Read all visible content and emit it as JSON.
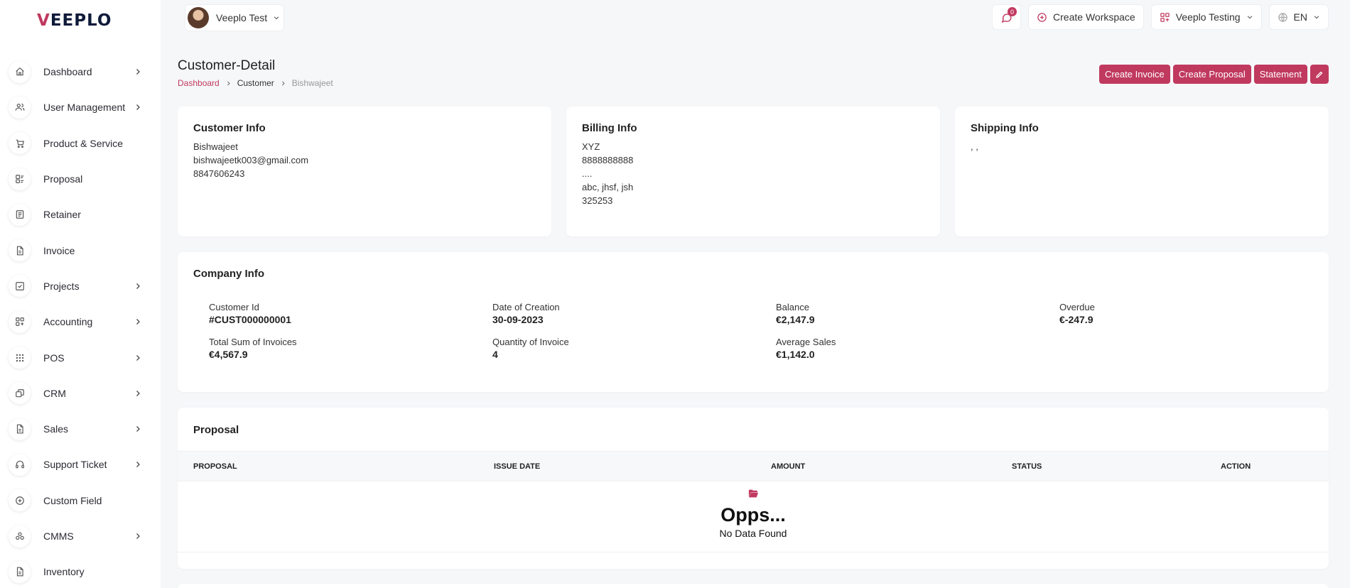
{
  "brand": {
    "logo_v": "V",
    "logo_rest": "EEPLO",
    "accent": "#c0395f"
  },
  "sidebar": {
    "items": [
      {
        "label": "Dashboard",
        "icon": "home-icon",
        "has_children": true
      },
      {
        "label": "User Management",
        "icon": "users-icon",
        "has_children": true
      },
      {
        "label": "Product & Service",
        "icon": "cart-icon",
        "has_children": false
      },
      {
        "label": "Proposal",
        "icon": "proposal-icon",
        "has_children": false
      },
      {
        "label": "Retainer",
        "icon": "retainer-icon",
        "has_children": false
      },
      {
        "label": "Invoice",
        "icon": "file-icon",
        "has_children": false
      },
      {
        "label": "Projects",
        "icon": "checklist-icon",
        "has_children": true
      },
      {
        "label": "Accounting",
        "icon": "layout-grid-icon",
        "has_children": true
      },
      {
        "label": "POS",
        "icon": "grid-dots-icon",
        "has_children": true
      },
      {
        "label": "CRM",
        "icon": "layers-icon",
        "has_children": true
      },
      {
        "label": "Sales",
        "icon": "file-icon",
        "has_children": true
      },
      {
        "label": "Support Ticket",
        "icon": "headset-icon",
        "has_children": true
      },
      {
        "label": "Custom Field",
        "icon": "plus-circle-icon",
        "has_children": false
      },
      {
        "label": "CMMS",
        "icon": "atom-icon",
        "has_children": true
      },
      {
        "label": "Inventory",
        "icon": "file-icon",
        "has_children": false
      }
    ]
  },
  "topbar": {
    "user_name": "Veeplo Test",
    "notification_count": "0",
    "create_workspace": "Create Workspace",
    "workspace_name": "Veeplo Testing",
    "language": "EN"
  },
  "page": {
    "title": "Customer-Detail",
    "breadcrumb": {
      "home": "Dashboard",
      "section": "Customer",
      "current": "Bishwajeet"
    },
    "actions": {
      "create_invoice": "Create Invoice",
      "create_proposal": "Create Proposal",
      "statement": "Statement"
    }
  },
  "customer_info": {
    "title": "Customer Info",
    "name": "Bishwajeet",
    "email": "bishwajeetk003@gmail.com",
    "phone": "8847606243"
  },
  "billing_info": {
    "title": "Billing Info",
    "name": "XYZ",
    "phone": "8888888888",
    "address": "....",
    "city": "abc, jhsf, jsh",
    "zip": "325253"
  },
  "shipping_info": {
    "title": "Shipping Info",
    "address": ", ,"
  },
  "company_info": {
    "title": "Company Info",
    "stats": [
      {
        "label": "Customer Id",
        "value": "#CUST000000001"
      },
      {
        "label": "Date of Creation",
        "value": "30-09-2023"
      },
      {
        "label": "Balance",
        "value": "€2,147.9"
      },
      {
        "label": "Overdue",
        "value": "€-247.9"
      },
      {
        "label": "Total Sum of Invoices",
        "value": "€4,567.9"
      },
      {
        "label": "Quantity of Invoice",
        "value": "4"
      },
      {
        "label": "Average Sales",
        "value": "€1,142.0"
      }
    ]
  },
  "proposal": {
    "title": "Proposal",
    "columns": [
      "PROPOSAL",
      "ISSUE DATE",
      "AMOUNT",
      "STATUS",
      "ACTION"
    ],
    "empty_title": "Opps...",
    "empty_message": "No Data Found"
  }
}
